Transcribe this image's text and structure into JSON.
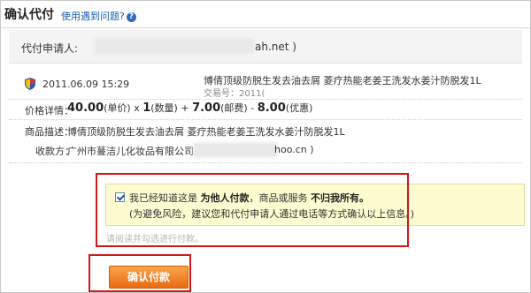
{
  "header": {
    "title": "确认代付",
    "help_link": "使用遇到问题?"
  },
  "applicant": {
    "label": "代付申请人:",
    "email_visible": "ah.net )"
  },
  "order": {
    "date": "2011.06.09 15:29",
    "product_name": "博倩顶级防脱生发去油去屑 菱疗热能老姜王洗发水姜汁防脱发1L",
    "trade_no": "交易号：2011("
  },
  "price": {
    "label": "价格详情：",
    "unit_price": "40.00",
    "unit_price_suffix": "(单价) x",
    "quantity": "1",
    "quantity_suffix": "(数量) +",
    "shipping": "7.00",
    "shipping_suffix": "(邮费) -",
    "discount": "8.00",
    "discount_suffix": "(优惠)"
  },
  "description": {
    "label": "商品描述：",
    "value": "博倩顶级防脱生发去油去屑 菱疗热能老姜王洗发水姜汁防脱发1L"
  },
  "payee": {
    "label": "收款方：",
    "value": "广州市蔓洁儿化妆品有限公司 (",
    "email_visible": "hoo.cn )"
  },
  "agreement": {
    "line1_prefix": "我已经知道这是",
    "line1_bold1": "为他人付款",
    "line1_mid": "，商品或服务",
    "line1_bold2": "不归我所有。",
    "line2": "(为避免风险，建议您和代付申请人通过电话等方式确认以上信息。)",
    "checked": true
  },
  "hint": "请阅读并勾选进行付款。",
  "confirm_button": "确认付款",
  "colors": {
    "accent_button": "#e86b12",
    "highlight_outline": "#d01818",
    "notice_bg": "#fdfbd0",
    "link": "#1a5fb0"
  }
}
